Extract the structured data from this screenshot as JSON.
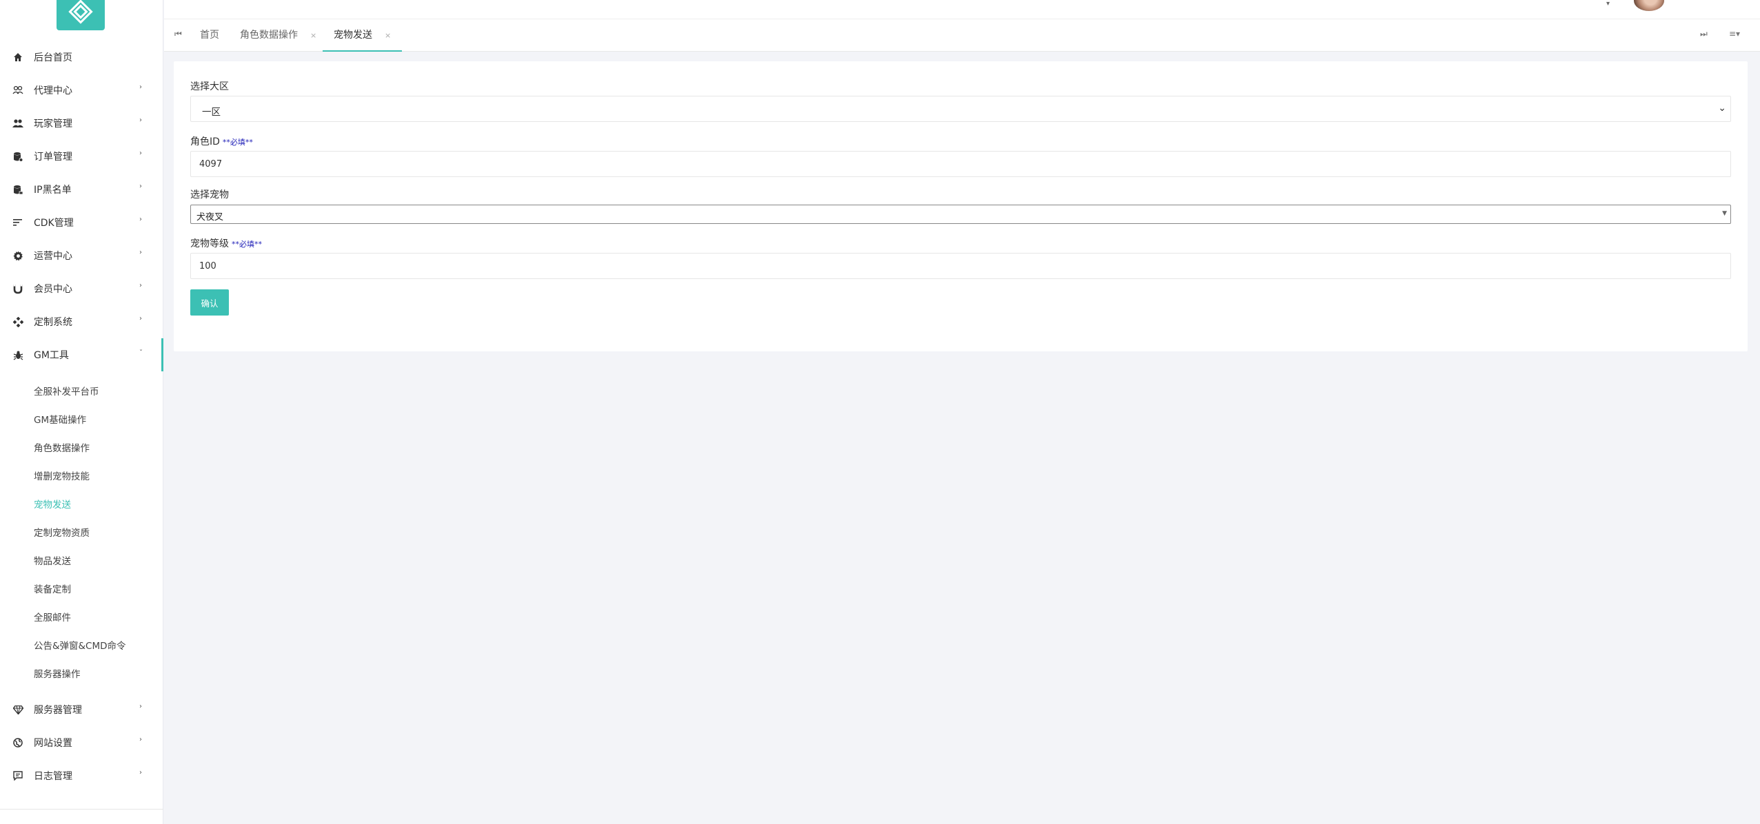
{
  "sidebar": {
    "items": [
      {
        "label": "后台首页",
        "icon": "home-icon"
      },
      {
        "label": "代理中心",
        "icon": "users-outline-icon"
      },
      {
        "label": "玩家管理",
        "icon": "group-icon"
      },
      {
        "label": "订单管理",
        "icon": "database-icon"
      },
      {
        "label": "IP黑名单",
        "icon": "database-lock-icon"
      },
      {
        "label": "CDK管理",
        "icon": "sort-lines-icon"
      },
      {
        "label": "运营中心",
        "icon": "gear-icon"
      },
      {
        "label": "会员中心",
        "icon": "magnet-icon"
      },
      {
        "label": "定制系统",
        "icon": "diamond-dots-icon"
      },
      {
        "label": "GM工具",
        "icon": "bug-icon"
      }
    ],
    "gm_sub_items": [
      "全服补发平台币",
      "GM基础操作",
      "角色数据操作",
      "增删宠物技能",
      "宠物发送",
      "定制宠物资质",
      "物品发送",
      "装备定制",
      "全服邮件",
      "公告&弹窗&CMD命令",
      "服务器操作"
    ],
    "bottom_items": [
      {
        "label": "服务器管理",
        "icon": "gem-icon"
      },
      {
        "label": "网站设置",
        "icon": "globe-icon"
      },
      {
        "label": "日志管理",
        "icon": "comment-icon"
      }
    ]
  },
  "tabs": [
    {
      "label": "首页"
    },
    {
      "label": "角色数据操作",
      "close": "×"
    },
    {
      "label": "宠物发送",
      "close": "×"
    }
  ],
  "tabbar": {
    "prev": "⏮",
    "next": "⏭",
    "menu": "≡▾"
  },
  "form": {
    "region_label": "选择大区",
    "region_value": "一区",
    "role_id_label": "角色ID",
    "role_id_required": "**必填**",
    "role_id_value": "4097",
    "pet_label": "选择宠物",
    "pet_value": "犬夜叉",
    "level_label": "宠物等级",
    "level_required": "**必填**",
    "level_value": "100",
    "confirm_label": "确认"
  },
  "colors": {
    "accent": "#3cc0b4",
    "background": "#f3f4f8",
    "required": "#2222b8"
  }
}
